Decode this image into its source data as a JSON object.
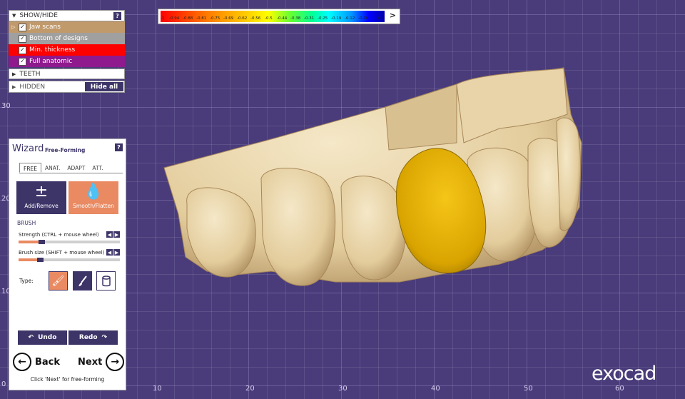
{
  "showhide": {
    "title": "SHOW/HIDE",
    "help": "?",
    "items": [
      {
        "label": "Jaw scans",
        "checked": true,
        "color": "#c19a6b",
        "expander": true
      },
      {
        "label": "Bottom of designs",
        "checked": true,
        "color": "#a0a0a0",
        "expander": false
      },
      {
        "label": "Min. thickness",
        "checked": true,
        "color": "#ff0000",
        "expander": false
      },
      {
        "label": "Full anatomic",
        "checked": true,
        "color": "#8e1a8e",
        "expander": false
      }
    ],
    "teeth_label": "TEETH",
    "hidden_label": "HIDDEN",
    "hide_all": "Hide all"
  },
  "colorscale": {
    "ticks": [
      "-1",
      "-0.94",
      "-0.88",
      "-0.81",
      "-0.75",
      "-0.69",
      "-0.62",
      "-0.56",
      "-0.5",
      "-0.44",
      "-0.38",
      "-0.31",
      "-0.25",
      "-0.19",
      "-0.12",
      "-0.06",
      "0"
    ],
    "arrow": ">"
  },
  "axes": {
    "x_ticks": [
      "0",
      "10",
      "20",
      "30",
      "40",
      "50",
      "60"
    ],
    "y_ticks": [
      "30",
      "20",
      "10",
      "0"
    ]
  },
  "wizard": {
    "title": "Wizard",
    "subtitle": "Free-Forming",
    "help": "?",
    "tabs": [
      "FREE",
      "ANAT.",
      "ADAPT",
      "ATT."
    ],
    "active_tab": "FREE",
    "add_remove": "Add/Remove",
    "smooth_flatten": "Smooth/Flatten",
    "brush_label": "BRUSH",
    "strength_label": "Strength (CTRL + mouse wheel)",
    "brushsize_label": "Brush size (SHIFT + mouse wheel)",
    "strength_value": 0.2,
    "brushsize_value": 0.18,
    "type_label": "Type:",
    "undo": "Undo",
    "redo": "Redo",
    "back": "Back",
    "next": "Next",
    "hint": "Click 'Next' for free-forming"
  },
  "logo": "exocad",
  "colors": {
    "accent": "#3d3468",
    "orange": "#e98a62",
    "background": "#4a3c7a",
    "tooth": "#e8d6ae",
    "crown": "#e0a800"
  }
}
